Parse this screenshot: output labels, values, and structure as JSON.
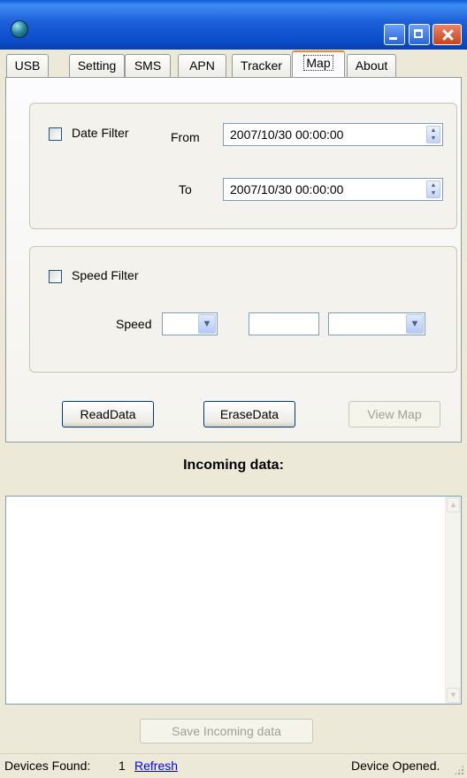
{
  "window": {
    "icon": "globe-icon",
    "controls": [
      "minimize-icon",
      "maximize-icon",
      "close-icon"
    ]
  },
  "tabs": [
    {
      "label": "USB"
    },
    {
      "label": "Setting"
    },
    {
      "label": "SMS"
    },
    {
      "label": "APN"
    },
    {
      "label": "Tracker"
    },
    {
      "label": "Map",
      "active": true
    },
    {
      "label": "About"
    }
  ],
  "date_filter": {
    "checkbox_label": "Date Filter",
    "checked": false,
    "from_label": "From",
    "from_value": "2007/10/30 00:00:00",
    "to_label": "To",
    "to_value": "2007/10/30 00:00:00"
  },
  "speed_filter": {
    "checkbox_label": "Speed Filter",
    "checked": false,
    "speed_label": "Speed",
    "operator_value": "",
    "speed_value": "",
    "unit_value": ""
  },
  "buttons": {
    "read_data": "ReadData",
    "erase_data": "EraseData",
    "view_map": "View Map"
  },
  "incoming": {
    "title": "Incoming data:",
    "content": "",
    "save_button": "Save Incoming data"
  },
  "status": {
    "devices_found_label": "Devices Found:",
    "devices_found_count": "1",
    "refresh_link": "Refresh",
    "device_state": "Device Opened."
  },
  "colors": {
    "window_face": "#ece9d8",
    "title_bar": "#0b4cc9",
    "active_tab_accent": "#e68b2c",
    "link": "#0000ff",
    "disabled_text": "#a19f93"
  }
}
